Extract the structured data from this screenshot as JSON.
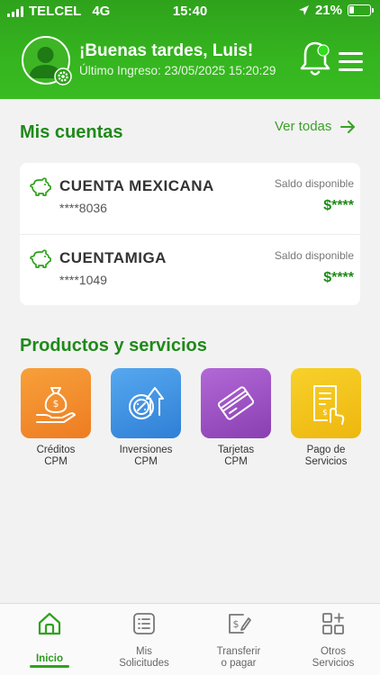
{
  "status_bar": {
    "carrier": "TELCEL",
    "network": "4G",
    "time": "15:40",
    "battery": "21%",
    "battery_level": 0.21
  },
  "header": {
    "greeting": "¡Buenas tardes, Luis!",
    "last_login": "Último Ingreso: 23/05/2025 15:20:29",
    "icons": [
      "avatar-icon",
      "settings-gear-icon",
      "notification-bell-icon",
      "menu-icon"
    ]
  },
  "accounts": {
    "title": "Mis cuentas",
    "see_all": "Ver todas",
    "items": [
      {
        "name": "CUENTA MEXICANA",
        "number": "****8036",
        "balance_label": "Saldo disponible",
        "balance": "$****",
        "icon": "piggy-bank-icon"
      },
      {
        "name": "CUENTAMIGA",
        "number": "****1049",
        "balance_label": "Saldo disponible",
        "balance": "$****",
        "icon": "piggy-bank-icon"
      }
    ]
  },
  "products": {
    "title": "Productos y servicios",
    "items": [
      {
        "line1": "Créditos",
        "line2": "CPM",
        "color": "#f28a2a",
        "icon": "money-bag-hand-icon"
      },
      {
        "line1": "Inversiones",
        "line2": "CPM",
        "color": "#3a8ee0",
        "icon": "investment-icon"
      },
      {
        "line1": "Tarjetas",
        "line2": "CPM",
        "color": "#9b4fc0",
        "icon": "card-icon"
      },
      {
        "line1": "Pago de",
        "line2": "Servicios",
        "color": "#f0c21a",
        "icon": "bill-payment-icon"
      }
    ]
  },
  "bottom_nav": {
    "items": [
      {
        "line1": "Inicio",
        "line2": "",
        "icon": "home-icon",
        "active": true
      },
      {
        "line1": "Mis",
        "line2": "Solicitudes",
        "icon": "list-icon",
        "active": false
      },
      {
        "line1": "Transferir",
        "line2": "o pagar",
        "icon": "transfer-icon",
        "active": false
      },
      {
        "line1": "Otros",
        "line2": "Servicios",
        "icon": "grid-plus-icon",
        "active": false
      }
    ]
  },
  "colors": {
    "brand_green": "#2fa21c",
    "title_green": "#1f8a1a"
  }
}
